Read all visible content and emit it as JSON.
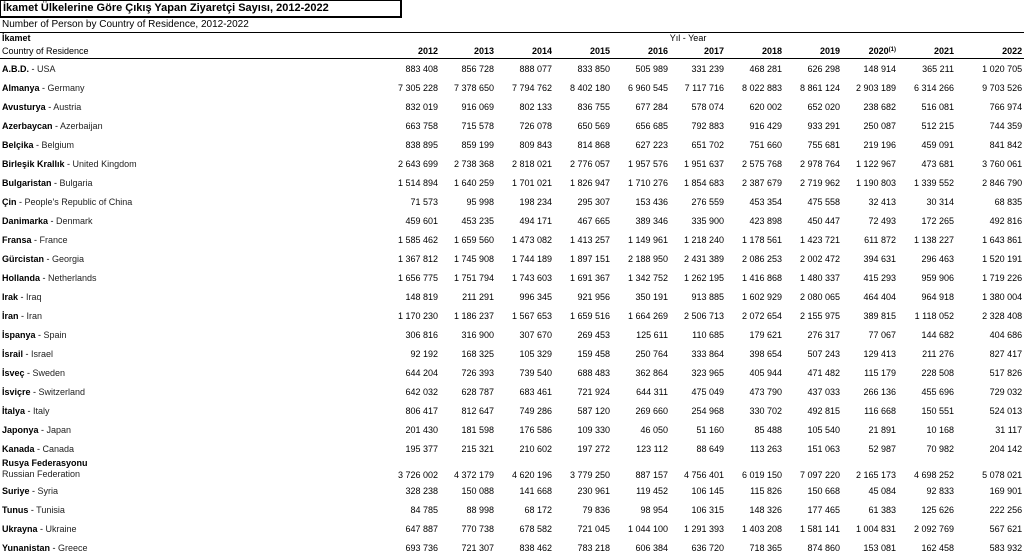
{
  "title": "İkamet Ülkelerine Göre Çıkış Yapan Ziyaretçi Sayısı, 2012-2022",
  "subtitle": "Number of Person by Country of Residence, 2012-2022",
  "header": {
    "ikamet": "İkamet",
    "country_of_residence": "Country of Residence",
    "yil_year": "Yıl - Year",
    "years": [
      "2012",
      "2013",
      "2014",
      "2015",
      "2016",
      "2017",
      "2018",
      "2019",
      "2020",
      "2021",
      "2022"
    ],
    "footnote_2020": "(1)"
  },
  "rows": [
    {
      "tr": "A.B.D.",
      "en": "USA",
      "v": [
        "883 408",
        "856 728",
        "888 077",
        "833 850",
        "505 989",
        "331 239",
        "468 281",
        "626 298",
        "148 914",
        "365 211",
        "1 020 705"
      ]
    },
    {
      "tr": "Almanya",
      "en": "Germany",
      "v": [
        "7 305 228",
        "7 378 650",
        "7 794 762",
        "8 402 180",
        "6 960 545",
        "7 117 716",
        "8 022 883",
        "8 861 124",
        "2 903 189",
        "6 314 266",
        "9 703 526"
      ]
    },
    {
      "tr": "Avusturya",
      "en": "Austria",
      "v": [
        "832 019",
        "916 069",
        "802 133",
        "836 755",
        "677 284",
        "578 074",
        "620 002",
        "652 020",
        "238 682",
        "516 081",
        "766 974"
      ]
    },
    {
      "tr": "Azerbaycan",
      "en": "Azerbaijan",
      "v": [
        "663 758",
        "715 578",
        "726 078",
        "650 569",
        "656 685",
        "792 883",
        "916 429",
        "933 291",
        "250 087",
        "512 215",
        "744 359"
      ]
    },
    {
      "tr": "Belçika",
      "en": "Belgium",
      "v": [
        "838 895",
        "859 199",
        "809 843",
        "814 868",
        "627 223",
        "651 702",
        "751 660",
        "755 681",
        "219 196",
        "459 091",
        "841 842"
      ]
    },
    {
      "tr": "Birleşik Krallık",
      "en": "United Kingdom",
      "v": [
        "2 643 699",
        "2 738 368",
        "2 818 021",
        "2 776 057",
        "1 957 576",
        "1 951 637",
        "2 575 768",
        "2 978 764",
        "1 122 967",
        "473 681",
        "3 760 061"
      ]
    },
    {
      "tr": "Bulgaristan",
      "en": "Bulgaria",
      "v": [
        "1 514 894",
        "1 640 259",
        "1 701 021",
        "1 826 947",
        "1 710 276",
        "1 854 683",
        "2 387 679",
        "2 719 962",
        "1 190 803",
        "1 339 552",
        "2 846 790"
      ]
    },
    {
      "tr": "Çin",
      "en": "People's Republic of China",
      "v": [
        "71 573",
        "95 998",
        "198 234",
        "295 307",
        "153 436",
        "276 559",
        "453 354",
        "475 558",
        "32 413",
        "30 314",
        "68 835"
      ]
    },
    {
      "tr": "Danimarka",
      "en": "Denmark",
      "v": [
        "459 601",
        "453 235",
        "494 171",
        "467 665",
        "389 346",
        "335 900",
        "423 898",
        "450 447",
        "72 493",
        "172 265",
        "492 816"
      ]
    },
    {
      "tr": "Fransa",
      "en": "France",
      "v": [
        "1 585 462",
        "1 659 560",
        "1 473 082",
        "1 413 257",
        "1 149 961",
        "1 218 240",
        "1 178 561",
        "1 423 721",
        "611 872",
        "1 138 227",
        "1 643 861"
      ]
    },
    {
      "tr": "Gürcistan",
      "en": "Georgia",
      "v": [
        "1 367 812",
        "1 745 908",
        "1 744 189",
        "1 897 151",
        "2 188 950",
        "2 431 389",
        "2 086 253",
        "2 002 472",
        "394 631",
        "296 463",
        "1 520 191"
      ]
    },
    {
      "tr": "Hollanda",
      "en": "Netherlands",
      "v": [
        "1 656 775",
        "1 751 794",
        "1 743 603",
        "1 691 367",
        "1 342 752",
        "1 262 195",
        "1 416 868",
        "1 480 337",
        "415 293",
        "959 906",
        "1 719 226"
      ]
    },
    {
      "tr": "Irak",
      "en": "Iraq",
      "v": [
        "148 819",
        "211 291",
        "996 345",
        "921 956",
        "350 191",
        "913 885",
        "1 602 929",
        "2 080 065",
        "464 404",
        "964 918",
        "1 380 004"
      ]
    },
    {
      "tr": "İran",
      "en": "Iran",
      "v": [
        "1 170 230",
        "1 186 237",
        "1 567 653",
        "1 659 516",
        "1 664 269",
        "2 506 713",
        "2 072 654",
        "2 155 975",
        "389 815",
        "1 118 052",
        "2 328 408"
      ]
    },
    {
      "tr": "İspanya",
      "en": "Spain",
      "v": [
        "306 816",
        "316 900",
        "307 670",
        "269 453",
        "125 611",
        "110 685",
        "179 621",
        "276 317",
        "77 067",
        "144 682",
        "404 686"
      ]
    },
    {
      "tr": "İsrail",
      "en": "Israel",
      "v": [
        "92 192",
        "168 325",
        "105 329",
        "159 458",
        "250 764",
        "333 864",
        "398 654",
        "507 243",
        "129 413",
        "211 276",
        "827 417"
      ]
    },
    {
      "tr": "İsveç",
      "en": "Sweden",
      "v": [
        "644 204",
        "726 393",
        "739 540",
        "688 483",
        "362 864",
        "323 965",
        "405 944",
        "471 482",
        "115 179",
        "228 508",
        "517 826"
      ]
    },
    {
      "tr": "İsviçre",
      "en": "Switzerland",
      "v": [
        "642 032",
        "628 787",
        "683 461",
        "721 924",
        "644 311",
        "475 049",
        "473 790",
        "437 033",
        "266 136",
        "455 696",
        "729 032"
      ]
    },
    {
      "tr": "İtalya",
      "en": "Italy",
      "v": [
        "806 417",
        "812 647",
        "749 286",
        "587 120",
        "269 660",
        "254 968",
        "330 702",
        "492 815",
        "116 668",
        "150 551",
        "524 013"
      ]
    },
    {
      "tr": "Japonya",
      "en": "Japan",
      "v": [
        "201 430",
        "181 598",
        "176 586",
        "109 330",
        "46 050",
        "51 160",
        "85 488",
        "105 540",
        "21 891",
        "10 168",
        "31 117"
      ]
    },
    {
      "tr": "Kanada",
      "en": "Canada",
      "v": [
        "195 377",
        "215 321",
        "210 602",
        "197 272",
        "123 112",
        "88 649",
        "113 263",
        "151 063",
        "52 987",
        "70 982",
        "204 142"
      ]
    },
    {
      "tr": "Rusya Federasyonu",
      "en": "Russian Federation",
      "v": [
        "3 726 002",
        "4 372 179",
        "4 620 196",
        "3 779 250",
        "887 157",
        "4 756 401",
        "6 019 150",
        "7 097 220",
        "2 165 173",
        "4 698 252",
        "5 078 021"
      ]
    },
    {
      "tr": "Suriye",
      "en": "Syria",
      "v": [
        "328 238",
        "150 088",
        "141 668",
        "230 961",
        "119 452",
        "106 145",
        "115 826",
        "150 668",
        "45 084",
        "92 833",
        "169 901"
      ]
    },
    {
      "tr": "Tunus",
      "en": "Tunisia",
      "v": [
        "84 785",
        "88 998",
        "68 172",
        "79 836",
        "98 954",
        "106 315",
        "148 326",
        "177 465",
        "61 383",
        "125 626",
        "222 256"
      ]
    },
    {
      "tr": "Ukrayna",
      "en": "Ukraine",
      "v": [
        "647 887",
        "770 738",
        "678 582",
        "721 045",
        "1 044 100",
        "1 291 393",
        "1 403 208",
        "1 581 141",
        "1 004 831",
        "2 092 769",
        "567 621"
      ]
    },
    {
      "tr": "Yunanistan",
      "en": "Greece",
      "v": [
        "693 736",
        "721 307",
        "838 462",
        "783 218",
        "606 384",
        "636 720",
        "718 365",
        "874 860",
        "153 081",
        "162 458",
        "583 932"
      ]
    }
  ]
}
